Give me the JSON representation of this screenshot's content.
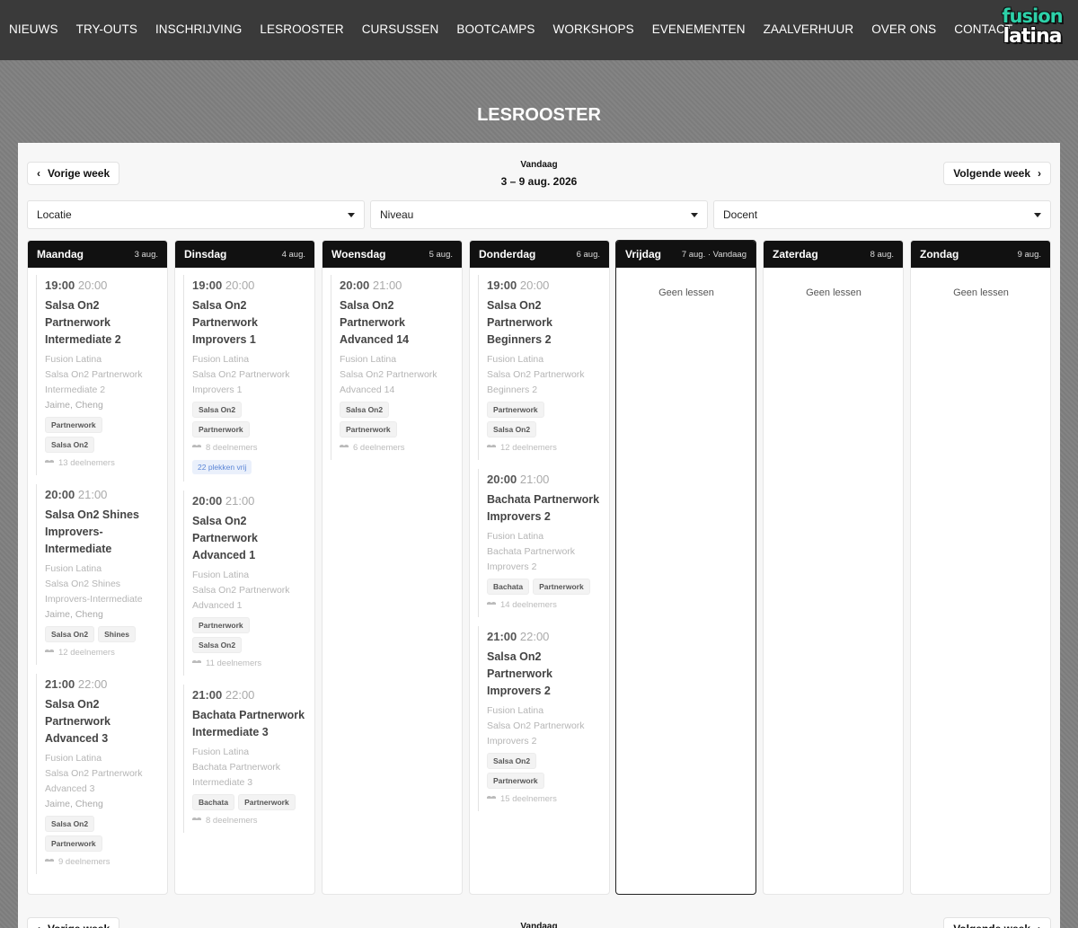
{
  "nav": {
    "items": [
      "NIEUWS",
      "TRY-OUTS",
      "INSCHRIJVING",
      "LESROOSTER",
      "CURSUSSEN",
      "BOOTCAMPS",
      "WORKSHOPS",
      "EVENEMENTEN",
      "ZAALVERHUUR",
      "OVER ONS",
      "CONTACT"
    ],
    "logo_line1": "fusion",
    "logo_line2": "latina"
  },
  "page_title": "LESROOSTER",
  "week_nav": {
    "prev_label": "Vorige week",
    "next_label": "Volgende week",
    "today_label": "Vandaag",
    "range": "3 – 9 aug. 2026"
  },
  "filters": {
    "location": "Locatie",
    "level": "Niveau",
    "teacher": "Docent"
  },
  "empty_label": "Geen lessen",
  "colors": {
    "header_bg": "#3a3a3a",
    "day_head_bg": "#111111",
    "spots_text": "#5c86d6",
    "logo_green": "#2dd0a8"
  },
  "days": [
    {
      "name": "Maandag",
      "date": "3 aug.",
      "lessons": [
        {
          "start": "19:00",
          "end": "20:00",
          "title": "Salsa On2 Partnerwork Intermediate 2",
          "location": "Fusion Latina",
          "course": "Salsa On2 Partnerwork Intermediate 2",
          "teacher": "Jaime, Cheng",
          "tags": [
            "Partnerwork",
            "Salsa On2"
          ],
          "participants": "13 deelnemers"
        },
        {
          "start": "20:00",
          "end": "21:00",
          "title": "Salsa On2 Shines Improvers-Intermediate",
          "location": "Fusion Latina",
          "course": "Salsa On2 Shines Improvers-Intermediate",
          "teacher": "Jaime, Cheng",
          "tags": [
            "Salsa On2",
            "Shines"
          ],
          "participants": "12 deelnemers"
        },
        {
          "start": "21:00",
          "end": "22:00",
          "title": "Salsa On2 Partnerwork Advanced 3",
          "location": "Fusion Latina",
          "course": "Salsa On2 Partnerwork Advanced 3",
          "teacher": "Jaime, Cheng",
          "tags": [
            "Salsa On2",
            "Partnerwork"
          ],
          "participants": "9 deelnemers"
        }
      ]
    },
    {
      "name": "Dinsdag",
      "date": "4 aug.",
      "lessons": [
        {
          "start": "19:00",
          "end": "20:00",
          "title": "Salsa On2 Partnerwork Improvers 1",
          "location": "Fusion Latina",
          "course": "Salsa On2 Partnerwork Improvers 1",
          "tags": [
            "Salsa On2",
            "Partnerwork"
          ],
          "participants": "8 deelnemers",
          "spots": "22 plekken vrij"
        },
        {
          "start": "20:00",
          "end": "21:00",
          "title": "Salsa On2 Partnerwork Advanced 1",
          "location": "Fusion Latina",
          "course": "Salsa On2 Partnerwork Advanced 1",
          "tags": [
            "Partnerwork",
            "Salsa On2"
          ],
          "participants": "11 deelnemers"
        },
        {
          "start": "21:00",
          "end": "22:00",
          "title": "Bachata Partnerwork Intermediate 3",
          "location": "Fusion Latina",
          "course": "Bachata Partnerwork Intermediate 3",
          "tags": [
            "Bachata",
            "Partnerwork"
          ],
          "participants": "8 deelnemers"
        }
      ]
    },
    {
      "name": "Woensdag",
      "date": "5 aug.",
      "lessons": [
        {
          "start": "20:00",
          "end": "21:00",
          "title": "Salsa On2 Partnerwork Advanced 14",
          "location": "Fusion Latina",
          "course": "Salsa On2 Partnerwork Advanced 14",
          "tags": [
            "Salsa On2",
            "Partnerwork"
          ],
          "participants": "6 deelnemers"
        }
      ]
    },
    {
      "name": "Donderdag",
      "date": "6 aug.",
      "lessons": [
        {
          "start": "19:00",
          "end": "20:00",
          "title": "Salsa On2 Partnerwork Beginners 2",
          "location": "Fusion Latina",
          "course": "Salsa On2 Partnerwork Beginners 2",
          "tags": [
            "Partnerwork",
            "Salsa On2"
          ],
          "participants": "12 deelnemers"
        },
        {
          "start": "20:00",
          "end": "21:00",
          "title": "Bachata Partnerwork Improvers 2",
          "location": "Fusion Latina",
          "course": "Bachata Partnerwork Improvers 2",
          "tags": [
            "Bachata",
            "Partnerwork"
          ],
          "participants": "14 deelnemers"
        },
        {
          "start": "21:00",
          "end": "22:00",
          "title": "Salsa On2 Partnerwork Improvers 2",
          "location": "Fusion Latina",
          "course": "Salsa On2 Partnerwork Improvers 2",
          "tags": [
            "Salsa On2",
            "Partnerwork"
          ],
          "participants": "15 deelnemers"
        }
      ]
    },
    {
      "name": "Vrijdag",
      "date": "7 aug. · Vandaag",
      "today": true,
      "lessons": []
    },
    {
      "name": "Zaterdag",
      "date": "8 aug.",
      "lessons": []
    },
    {
      "name": "Zondag",
      "date": "9 aug.",
      "lessons": []
    }
  ]
}
